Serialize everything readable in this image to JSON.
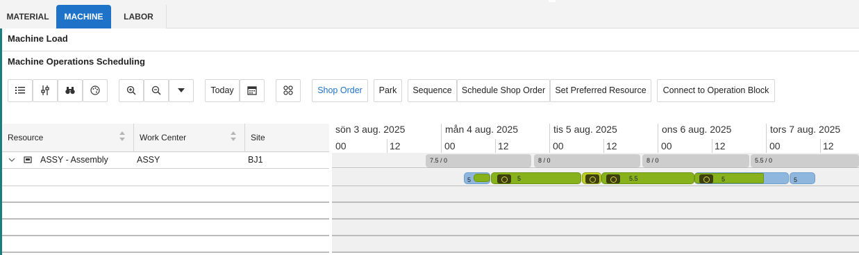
{
  "tabs": [
    {
      "label": "MATERIAL",
      "active": false
    },
    {
      "label": "MACHINE",
      "active": true
    },
    {
      "label": "LABOR",
      "active": false
    }
  ],
  "section_title": "Machine Load",
  "subsection_title": "Machine Operations Scheduling",
  "toolbar": {
    "icons": [
      "list-icon",
      "sliders-icon",
      "binoculars-icon",
      "palette-icon",
      "zoom-in-icon",
      "zoom-out-icon",
      "dropdown-icon",
      "calendar-icon",
      "grid-icon"
    ],
    "today_label": "Today",
    "shop_order_label": "Shop Order",
    "park_label": "Park",
    "sequence_label": "Sequence",
    "schedule_shop_order_label": "Schedule Shop Order",
    "set_preferred_resource_label": "Set Preferred Resource",
    "connect_label": "Connect to Operation Block"
  },
  "grid": {
    "columns": [
      "Resource",
      "Work Center",
      "Site"
    ],
    "rows": [
      {
        "resource": "ASSY - Assembly",
        "work_center": "ASSY",
        "site": "BJ1"
      }
    ]
  },
  "timeline": {
    "days": [
      "sön 3 aug. 2025",
      "mån 4 aug. 2025",
      "tis 5 aug. 2025",
      "ons 6 aug. 2025",
      "tors 7 aug. 2025"
    ],
    "hours": [
      "00",
      "12"
    ],
    "capacity": [
      "7.5 / 0",
      "8 / 0",
      "8 / 0",
      "5.5 / 0"
    ],
    "block_values": [
      "5",
      "5",
      "5.5",
      "5",
      "5"
    ]
  },
  "colors": {
    "accent": "#1e73c9",
    "left_bar": "#1a7d80",
    "block_blue": "#8fb7de",
    "block_green": "#88b21c"
  }
}
